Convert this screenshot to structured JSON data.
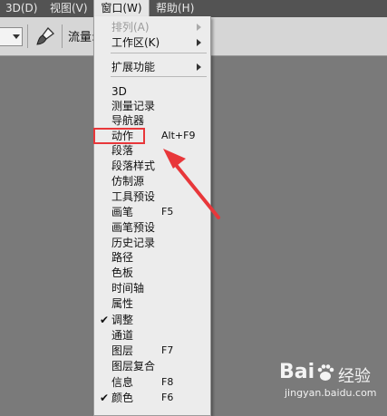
{
  "menubar": {
    "items": [
      {
        "label": "3D(D)"
      },
      {
        "label": "视图(V)"
      },
      {
        "label": "窗口(W)"
      },
      {
        "label": "帮助(H)"
      }
    ]
  },
  "options_bar": {
    "flow_label": "流量:"
  },
  "window_menu": {
    "items": [
      {
        "label": "排列(A)",
        "shortcut": "",
        "submenu": true,
        "disabled": true,
        "checked": false
      },
      {
        "label": "工作区(K)",
        "shortcut": "",
        "submenu": true,
        "disabled": false,
        "checked": false
      },
      {
        "label": "扩展功能",
        "shortcut": "",
        "submenu": true,
        "disabled": false,
        "checked": false
      },
      {
        "label": "3D",
        "shortcut": "",
        "submenu": false,
        "disabled": false,
        "checked": false
      },
      {
        "label": "测量记录",
        "shortcut": "",
        "submenu": false,
        "disabled": false,
        "checked": false
      },
      {
        "label": "导航器",
        "shortcut": "",
        "submenu": false,
        "disabled": false,
        "checked": false
      },
      {
        "label": "动作",
        "shortcut": "Alt+F9",
        "submenu": false,
        "disabled": false,
        "checked": false
      },
      {
        "label": "段落",
        "shortcut": "",
        "submenu": false,
        "disabled": false,
        "checked": false
      },
      {
        "label": "段落样式",
        "shortcut": "",
        "submenu": false,
        "disabled": false,
        "checked": false
      },
      {
        "label": "仿制源",
        "shortcut": "",
        "submenu": false,
        "disabled": false,
        "checked": false
      },
      {
        "label": "工具预设",
        "shortcut": "",
        "submenu": false,
        "disabled": false,
        "checked": false
      },
      {
        "label": "画笔",
        "shortcut": "F5",
        "submenu": false,
        "disabled": false,
        "checked": false
      },
      {
        "label": "画笔预设",
        "shortcut": "",
        "submenu": false,
        "disabled": false,
        "checked": false
      },
      {
        "label": "历史记录",
        "shortcut": "",
        "submenu": false,
        "disabled": false,
        "checked": false
      },
      {
        "label": "路径",
        "shortcut": "",
        "submenu": false,
        "disabled": false,
        "checked": false
      },
      {
        "label": "色板",
        "shortcut": "",
        "submenu": false,
        "disabled": false,
        "checked": false
      },
      {
        "label": "时间轴",
        "shortcut": "",
        "submenu": false,
        "disabled": false,
        "checked": false
      },
      {
        "label": "属性",
        "shortcut": "",
        "submenu": false,
        "disabled": false,
        "checked": false
      },
      {
        "label": "调整",
        "shortcut": "",
        "submenu": false,
        "disabled": false,
        "checked": true
      },
      {
        "label": "通道",
        "shortcut": "",
        "submenu": false,
        "disabled": false,
        "checked": false
      },
      {
        "label": "图层",
        "shortcut": "F7",
        "submenu": false,
        "disabled": false,
        "checked": false
      },
      {
        "label": "图层复合",
        "shortcut": "",
        "submenu": false,
        "disabled": false,
        "checked": false
      },
      {
        "label": "信息",
        "shortcut": "F8",
        "submenu": false,
        "disabled": false,
        "checked": false
      },
      {
        "label": "颜色",
        "shortcut": "F6",
        "submenu": false,
        "disabled": false,
        "checked": true
      }
    ]
  },
  "annotation": {
    "highlight_color": "#e8373a"
  },
  "watermark": {
    "logo": "Bai",
    "cn": "经验",
    "url": "jingyan.baidu.com"
  },
  "icons": {
    "combo_arrow": "chevron-down-icon",
    "brush": "brush-icon",
    "submenu": "chevron-right-icon",
    "check": "check-icon",
    "paw": "baidu-paw-icon"
  }
}
